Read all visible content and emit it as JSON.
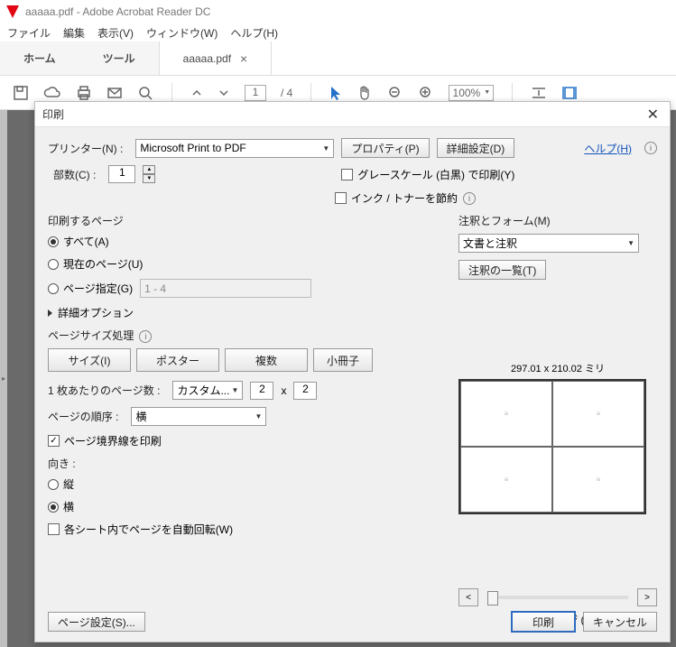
{
  "app": {
    "title": "aaaaa.pdf - Adobe Acrobat Reader DC",
    "menu": [
      "ファイル",
      "編集",
      "表示(V)",
      "ウィンドウ(W)",
      "ヘルプ(H)"
    ],
    "tabs": {
      "home": "ホーム",
      "tool": "ツール",
      "doc": "aaaaa.pdf"
    },
    "toolbar": {
      "page": "1",
      "pages": "/ 4",
      "zoom": "100%"
    }
  },
  "dlg": {
    "title": "印刷",
    "help": "ヘルプ(H)",
    "printer": {
      "label": "プリンター(N) :",
      "value": "Microsoft Print to PDF",
      "properties": "プロパティ(P)",
      "advanced": "詳細設定(D)"
    },
    "copies": {
      "label": "部数(C) :",
      "value": "1"
    },
    "grayscale": "グレースケール (白黒) で印刷(Y)",
    "savetoner": "インク / トナーを節約",
    "pagesgrp": {
      "label": "印刷するページ",
      "all": "すべて(A)",
      "current": "現在のページ(U)",
      "range": "ページ指定(G)",
      "range_value": "1 - 4",
      "more": "詳細オプション"
    },
    "sizegrp": {
      "label": "ページサイズ処理",
      "size": "サイズ(I)",
      "poster": "ポスター",
      "multiple": "複数",
      "booklet": "小冊子",
      "persheet_label": "1 枚あたりのページ数 :",
      "persheet_value": "カスタム...",
      "x": "x",
      "n1": "2",
      "n2": "2",
      "order_label": "ページの順序 :",
      "order_value": "横",
      "border": "ページ境界線を印刷"
    },
    "orient": {
      "label": "向き :",
      "portrait": "縦",
      "landscape": "横",
      "autorotate": "各シート内でページを自動回転(W)"
    },
    "comments": {
      "label": "注釈とフォーム(M)",
      "value": "文書と注釈",
      "summary": "注釈の一覧(T)"
    },
    "preview": {
      "dims": "297.01 x 210.02 ミリ",
      "page": "1 / 1 ページ (1)",
      "cells": [
        "≡",
        "≡",
        "≡",
        "≡"
      ]
    },
    "footer": {
      "pagesetup": "ページ設定(S)...",
      "print": "印刷",
      "cancel": "キャンセル"
    }
  }
}
